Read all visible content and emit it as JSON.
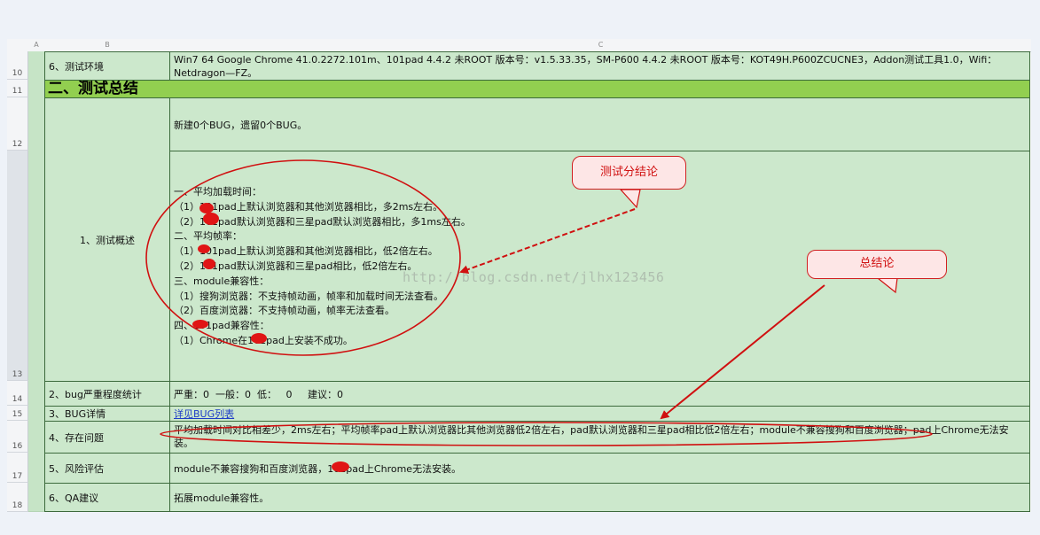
{
  "columns": {
    "a": "A",
    "b": "B",
    "c": "C"
  },
  "rows": {
    "r10": {
      "num": "10",
      "label": "6、测试环境",
      "value": "Win7 64 Google Chrome  41.0.2272.101m、101pad 4.4.2 未ROOT 版本号：v1.5.33.35，SM-P600 4.4.2 未ROOT 版本号：KOT49H.P600ZCUCNE3，Addon测试工具1.0，Wifi：Netdragon—FZ。"
    },
    "r11": {
      "num": "11",
      "section_title": "二、测试总结"
    },
    "r12": {
      "num": "12",
      "value": "新建0个BUG，遗留0个BUG。"
    },
    "r13": {
      "num": "13",
      "label": "1、测试概述",
      "lines": [
        "一、平均加载时间：",
        "（1）101pad上默认浏览器和其他浏览器相比，多2ms左右。",
        "（2）101pad默认浏览器和三星pad默认浏览器相比，多1ms左右。",
        "二、平均帧率：",
        "（1）101pad上默认浏览器和其他浏览器相比，低2倍左右。",
        "（2）101pad默认浏览器和三星pad相比，低2倍左右。",
        "三、module兼容性：",
        "（1）搜狗浏览器：不支持帧动画，帧率和加载时间无法查看。",
        "（2）百度浏览器：不支持帧动画，帧率无法查看。",
        "四、101pad兼容性：",
        "（1）Chrome在101pad上安装不成功。"
      ]
    },
    "r14": {
      "num": "14",
      "label": "2、bug严重程度统计",
      "value": "严重：0  一般：0  低：   0     建议：0"
    },
    "r15": {
      "num": "15",
      "label": "3、BUG详情",
      "value": "详见BUG列表"
    },
    "r16": {
      "num": "16",
      "label": "4、存在问题",
      "value": "平均加载时间对比相差少，2ms左右；平均帧率pad上默认浏览器比其他浏览器低2倍左右，pad默认浏览器和三星pad相比低2倍左右；module不兼容搜狗和百度浏览器；pad上Chrome无法安装。"
    },
    "r17": {
      "num": "17",
      "label": "5、风险评估",
      "value": "module不兼容搜狗和百度浏览器，101pad上Chrome无法安装。"
    },
    "r18": {
      "num": "18",
      "label": "6、QA建议",
      "value": "拓展module兼容性。"
    }
  },
  "annotations": {
    "callout_partial": "测试分结论",
    "callout_overall": "总结论",
    "color": "#d01010"
  },
  "watermark": "http://blog.csdn.net/jlhx123456",
  "colors": {
    "cell_bg": "#cce8cc",
    "title_bg": "#92cf50",
    "border": "#3c6a3c"
  }
}
